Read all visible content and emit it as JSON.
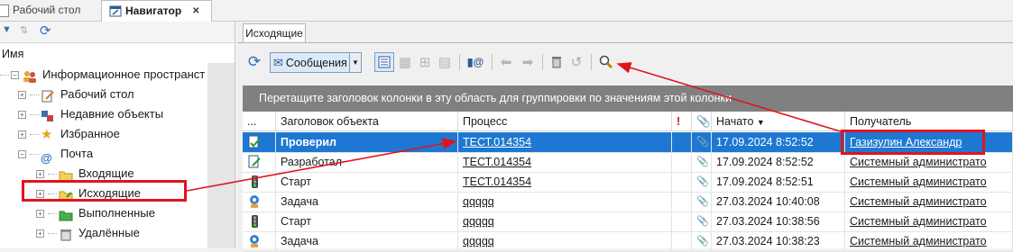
{
  "tabs": {
    "desktop": "Рабочий стол",
    "navigator": "Навигатор"
  },
  "tree": {
    "column_header": "Имя",
    "items": [
      {
        "label": "Информационное пространст"
      },
      {
        "label": "Рабочий стол"
      },
      {
        "label": "Недавние объекты"
      },
      {
        "label": "Избранное"
      },
      {
        "label": "Почта"
      },
      {
        "label": "Входящие"
      },
      {
        "label": "Исходящие"
      },
      {
        "label": "Выполненные"
      },
      {
        "label": "Удалённые"
      }
    ]
  },
  "main": {
    "tab": "Исходящие",
    "toolbar": {
      "type_combo": "Сообщения"
    },
    "group_hint": "Перетащите заголовок колонки в эту область для группировки по значениям этой колонки",
    "columns": {
      "indicator": "...",
      "title": "Заголовок объекта",
      "process": "Процесс",
      "priority": "!",
      "attach": "⊘",
      "started": "Начато",
      "recipient": "Получатель"
    },
    "rows": [
      {
        "icon": "task-done-icon",
        "title": "Проверил",
        "process": "ТЕСТ.014354",
        "started": "17.09.2024 8:52:52",
        "recipient": "Газизулин Александр"
      },
      {
        "icon": "task-edit-icon",
        "title": "Разработал",
        "process": "ТЕСТ.014354",
        "started": "17.09.2024 8:52:52",
        "recipient": "Системный администрато"
      },
      {
        "icon": "traffic-light-icon",
        "title": "Старт",
        "process": "ТЕСТ.014354",
        "started": "17.09.2024 8:52:51",
        "recipient": "Системный администрато"
      },
      {
        "icon": "gear-task-icon",
        "title": "Задача",
        "process": "qqqqq",
        "started": "27.03.2024 10:40:08",
        "recipient": "Системный администрато"
      },
      {
        "icon": "traffic-light-icon",
        "title": "Старт",
        "process": "qqqqq",
        "started": "27.03.2024 10:38:56",
        "recipient": "Системный администрато"
      },
      {
        "icon": "gear-task-icon",
        "title": "Задача",
        "process": "qqqqq",
        "started": "27.03.2024 10:38:23",
        "recipient": "Системный администрато"
      }
    ]
  },
  "colors": {
    "selection": "#1e78d2",
    "annotation": "#e0141e",
    "group_bar": "#808080"
  }
}
